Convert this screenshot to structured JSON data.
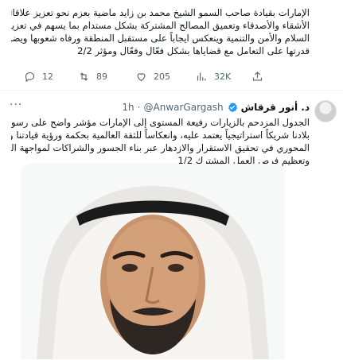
{
  "tweet1": {
    "lines": [
      "الإمارات بقيادة صاحب السمو الشيخ محمد بن زايد ماضية بعزم نحو تعزيز علاقاتها مع",
      "الأشقاء والأصدقاء وتعميق المصالح المشتركة بشكل مستدام بما يسهم في تعزيز",
      "السلام والأمن والتنمية وينعكس ايجاباً على مستقبل المنطقة ورفاه شعوبها ويضمن",
      "قدرتها على التعامل مع قضاياها بشكل فعّال وفعّال ومؤثر 2/2"
    ],
    "stats": {
      "replies": "12",
      "retweets": "89",
      "likes": "205",
      "views": "32K"
    }
  },
  "tweet2": {
    "author_name": "د. أنور قرقاش",
    "handle": "@AnwarGargash",
    "separator": "·",
    "time": "1h",
    "more": "···",
    "lines": [
      "الجدول المزدحم بالزيارات رفيعة المستوى إلى الإمارات مؤشر واضح على رسوخ مكانة",
      "بلادنا شريكاً استراتيجياً يعتمد عليه، وانعكاساً للثقة العالمية بحكمة ورؤية قيادتنا ودورها",
      "المحوري في تحقيق الاستقرار والازدهار عبر بناء الجسور والشراكات لمواجهة التحديات",
      "وتعظيم فرص العمل المشترك 1/2"
    ]
  },
  "icons": {
    "reply": "reply-icon",
    "retweet": "retweet-icon",
    "like": "heart-icon",
    "views": "views-icon",
    "share": "share-icon",
    "verified": "verified-badge-icon",
    "more": "more-options-icon"
  },
  "colors": {
    "text": "#0f1419",
    "secondary": "#536471",
    "verified": "#1d9bf0",
    "divider": "#eff3f4"
  }
}
